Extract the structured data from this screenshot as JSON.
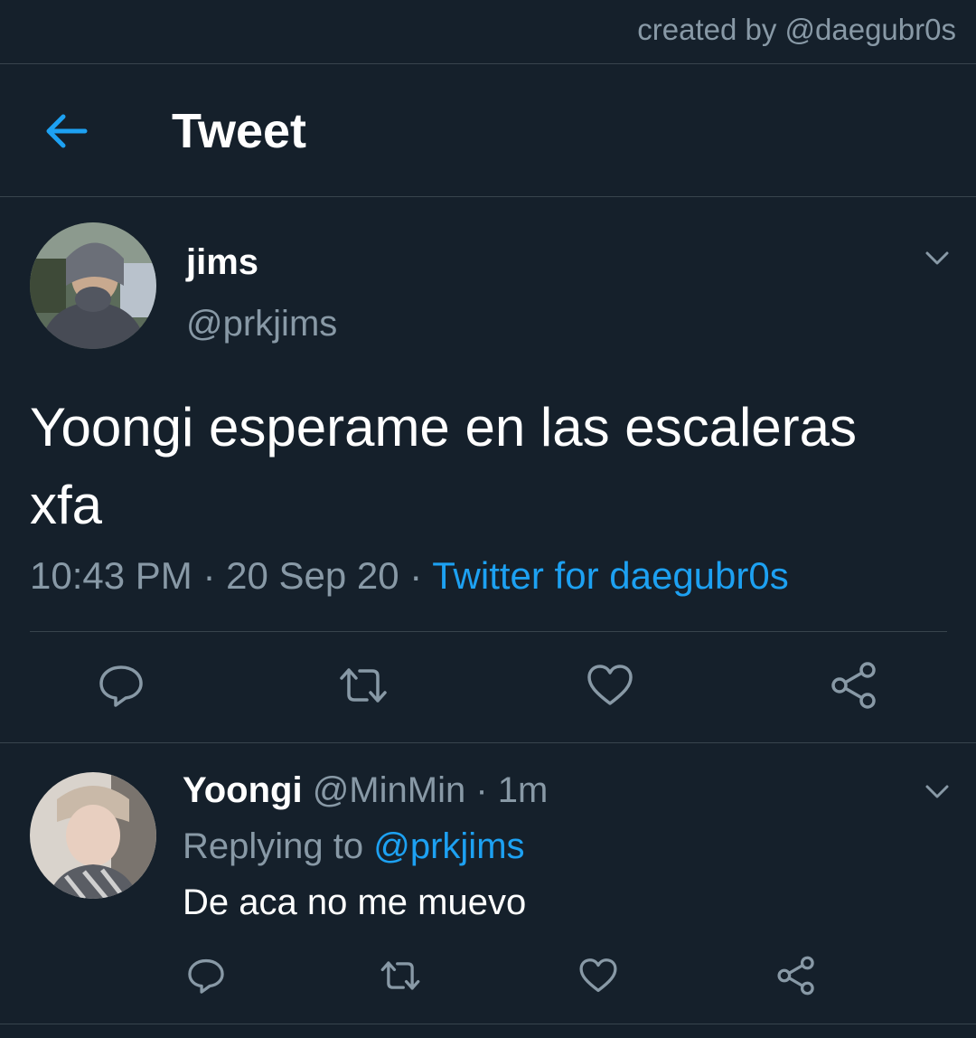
{
  "credit": "created by @daegubr0s",
  "header": {
    "title": "Tweet",
    "back_icon": "arrow-left-icon"
  },
  "tweet": {
    "display_name": "jims",
    "handle": "@prkjims",
    "text": "Yoongi esperame en las escaleras xfa",
    "time": "10:43 PM",
    "date": "20 Sep 20",
    "source": "Twitter for daegubr0s",
    "actions": [
      "reply-icon",
      "retweet-icon",
      "like-icon",
      "share-icon"
    ]
  },
  "reply": {
    "display_name": "Yoongi",
    "handle": "@MinMin",
    "time": "1m",
    "replying_label": "Replying to",
    "replying_to": "@prkjims",
    "text": "De aca no me muevo"
  },
  "colors": {
    "background": "#15202b",
    "accent": "#1da1f2",
    "secondary_text": "#8899a6",
    "border": "#38444d"
  }
}
